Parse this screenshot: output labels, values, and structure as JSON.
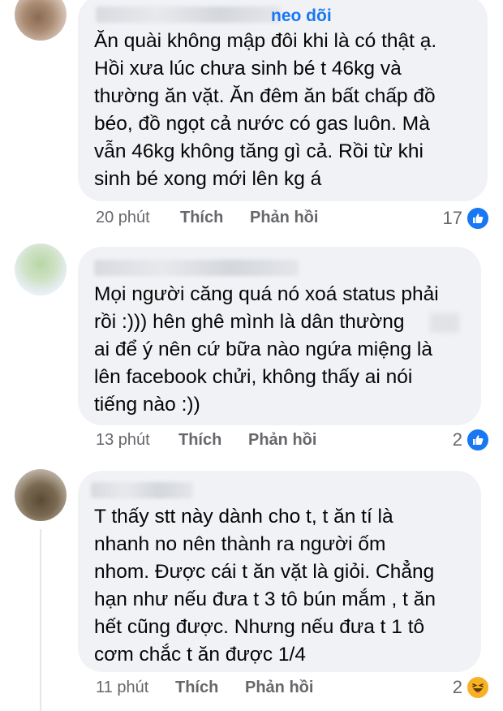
{
  "comments": [
    {
      "author_suffix": "neo dõi",
      "lines": [
        "Ăn quài không mập đôi khi là có thật ạ.",
        "Hồi xưa lúc chưa sinh bé t 46kg và",
        "thường ăn vặt. Ăn đêm ăn bất chấp đồ",
        "béo, đồ ngọt cả nước có gas luôn. Mà",
        "vẫn 46kg không tăng gì cả. Rồi từ khi",
        "sinh bé xong mới lên kg á"
      ],
      "time": "20 phút",
      "like_label": "Thích",
      "reply_label": "Phản hồi",
      "reaction_count": "17",
      "reaction_icon": "like-icon"
    },
    {
      "lines": [
        "Mọi người căng quá nó xoá status phải",
        "rồi :))) hên ghê mình là dân thường",
        "ai để ý nên cứ bữa nào ngứa miệng là",
        "lên facebook chửi, không thấy ai nói",
        "tiếng nào :))"
      ],
      "time": "13 phút",
      "like_label": "Thích",
      "reply_label": "Phản hồi",
      "reaction_count": "2",
      "reaction_icon": "like-icon"
    },
    {
      "lines": [
        "T thấy stt này dành cho t, t ăn tí là",
        "nhanh no nên thành ra người ốm",
        "nhom. Được cái t ăn vặt là giỏi. Chẳng",
        "hạn như nếu đưa t 3 tô bún mắm , t ăn",
        "hết cũng được. Nhưng nếu đưa t 1 tô",
        "cơm chắc t ăn được 1/4"
      ],
      "time": "11 phút",
      "like_label": "Thích",
      "reply_label": "Phản hồi",
      "reaction_count": "2",
      "reaction_icon": "haha-icon"
    }
  ],
  "colors": {
    "accent": "#1877f2",
    "bubble": "#f0f2f5",
    "meta_text": "#65676b",
    "haha": "#f7b125"
  }
}
